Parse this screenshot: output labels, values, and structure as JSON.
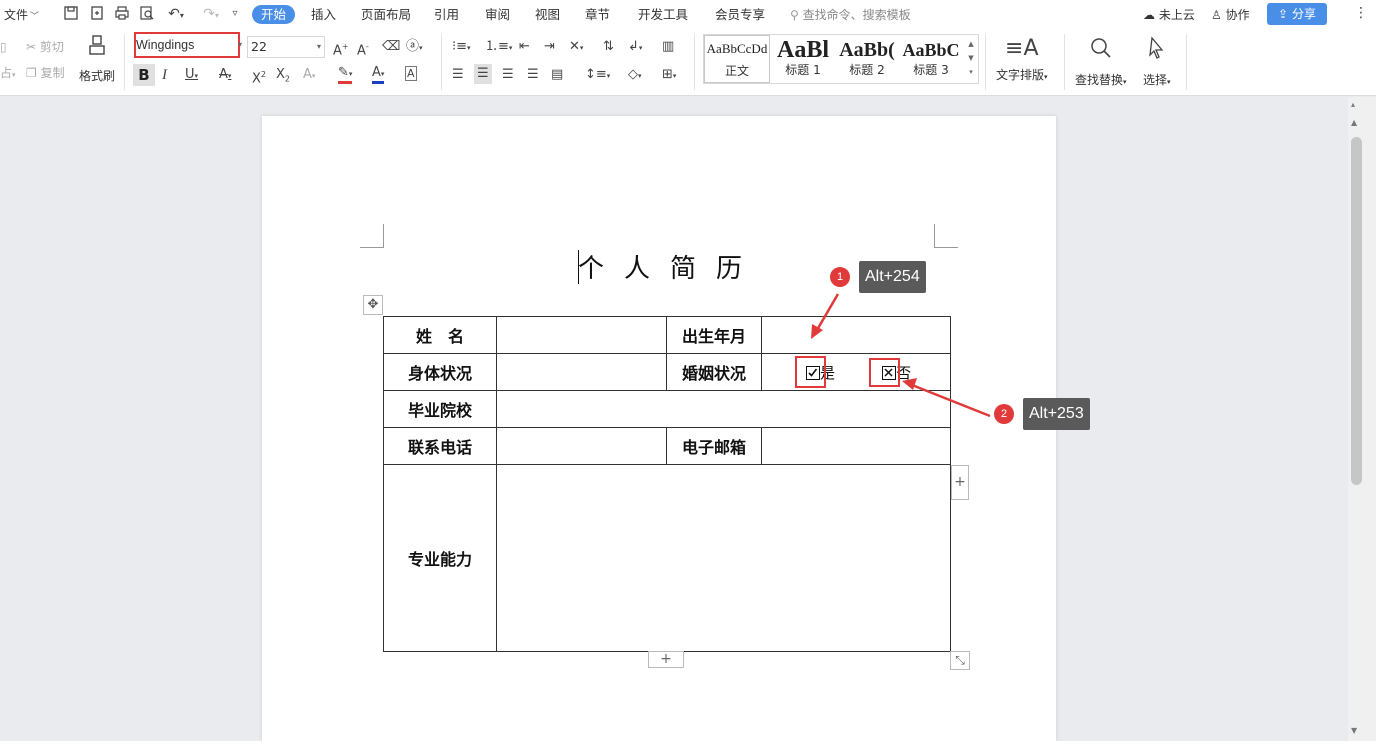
{
  "menubar": {
    "file": "文件",
    "tabs": [
      "开始",
      "插入",
      "页面布局",
      "引用",
      "审阅",
      "视图",
      "章节",
      "开发工具",
      "会员专享"
    ],
    "active_tab": "开始",
    "search_placeholder": "查找命令、搜索模板",
    "cloud": "未上云",
    "collab": "协作",
    "share": "分享"
  },
  "ribbon": {
    "cut": "剪切",
    "copy": "复制",
    "paste_fragment": "占",
    "format_painter": "格式刷",
    "font_name": "Wingdings",
    "font_size": "22",
    "styles": [
      {
        "preview": "AaBbCcDd",
        "label": "正文"
      },
      {
        "preview": "AaBl",
        "label": "标题 1"
      },
      {
        "preview": "AaBb(",
        "label": "标题 2"
      },
      {
        "preview": "AaBbC",
        "label": "标题 3"
      }
    ],
    "text_layout": "文字排版",
    "find_replace": "查找替换",
    "select": "选择"
  },
  "document": {
    "title": "个人简历",
    "table": {
      "name_label": "姓　名",
      "birth_label": "出生年月",
      "health_label": "身体状况",
      "marital_label": "婚姻状况",
      "yes_label": "是",
      "no_label": "否",
      "school_label": "毕业院校",
      "phone_label": "联系电话",
      "email_label": "电子邮箱",
      "skills_label": "专业能力"
    }
  },
  "annotations": {
    "one_num": "1",
    "one_text": "Alt+254",
    "two_num": "2",
    "two_text": "Alt+253"
  },
  "colors": {
    "accent": "#4a8fe7",
    "highlight": "#e03a3a",
    "tooltip": "#5a5a5a"
  }
}
